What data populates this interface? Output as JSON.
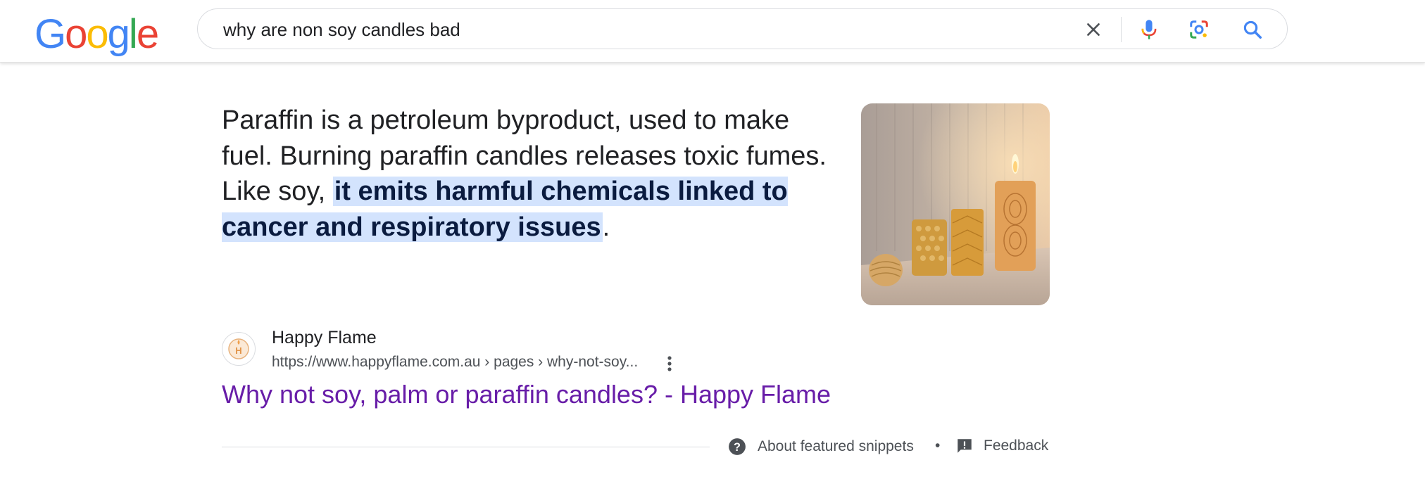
{
  "header": {
    "logo_letters": [
      "G",
      "o",
      "o",
      "g",
      "l",
      "e"
    ],
    "logo_colors": [
      "#4285F4",
      "#EA4335",
      "#FBBC05",
      "#4285F4",
      "#34A853",
      "#EA4335"
    ],
    "search_query": "why are non soy candles bad",
    "icons": [
      "clear-icon",
      "microphone-icon",
      "google-lens-icon",
      "search-icon"
    ]
  },
  "snippet": {
    "text_before": "Paraffin is a petroleum byproduct, used to make fuel. Burning paraffin candles releases toxic fumes. Like soy, ",
    "highlight": "it emits harmful chemicals linked to cancer and respiratory issues",
    "text_after": ".",
    "image_alt": "candles-photo"
  },
  "source": {
    "favicon_letter": "H",
    "site_name": "Happy Flame",
    "url": "https://www.happyflame.com.au › pages › why-not-soy...",
    "title": "Why not soy, palm or paraffin candles? - Happy Flame"
  },
  "footer": {
    "about_label": "About featured snippets",
    "separator": "•",
    "feedback_label": "Feedback"
  },
  "colors": {
    "link_visited": "#681da8",
    "highlight_bg": "#d3e3fd",
    "search_blue": "#4285F4"
  }
}
